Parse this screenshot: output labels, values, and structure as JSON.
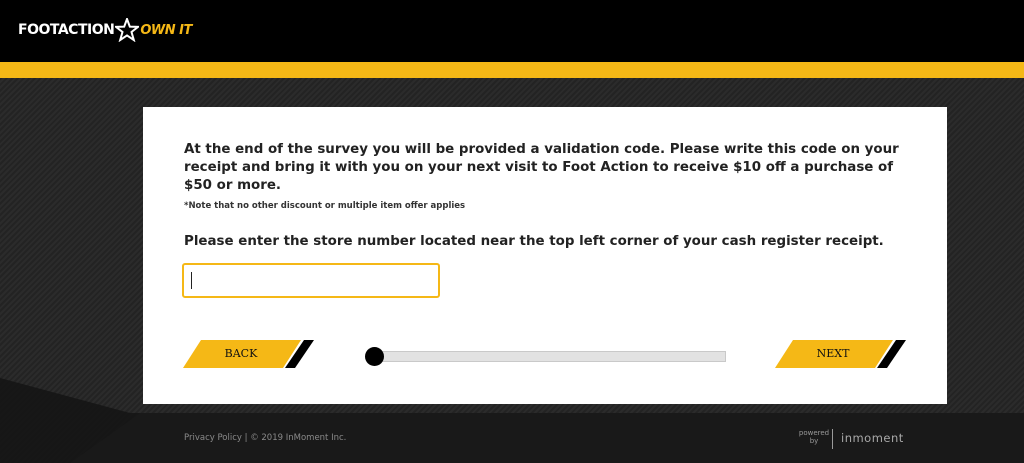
{
  "header": {
    "logo_word": "FOOTACTION",
    "logo_tag": "OWN IT"
  },
  "colors": {
    "accent": "#f5b816",
    "header_bg": "#000000",
    "page_bg": "#1f1f1f",
    "card_bg": "#ffffff"
  },
  "survey": {
    "intro": "At the end of the survey you will be provided a validation code. Please write this code on your receipt and bring it with you on your next visit to Foot Action to receive $10 off a purchase of $50 or more.",
    "note": "*Note that no other discount or multiple item offer applies",
    "question": "Please enter the store number located near the top left corner of your cash register receipt.",
    "store_number_value": ""
  },
  "nav": {
    "back_label": "BACK",
    "next_label": "NEXT",
    "progress_fraction": 0.0
  },
  "footer": {
    "copyright": "Privacy Policy | © 2019 InMoment Inc.",
    "powered_line1": "powered",
    "powered_line2": "by",
    "brand": "inmoment"
  },
  "icons": [
    "star-icon",
    "stripe-decoration-icon"
  ]
}
